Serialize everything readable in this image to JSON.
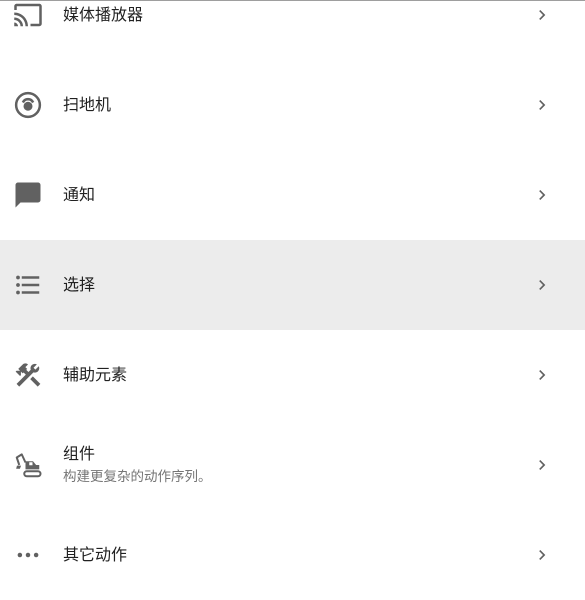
{
  "colors": {
    "icon": "#616161",
    "text": "#212121",
    "secondary_text": "#757575",
    "selected_background": "#ececec",
    "chevron": "#616161"
  },
  "menu": {
    "items": [
      {
        "label": "媒体播放器",
        "icon": "cast-icon",
        "selected": false
      },
      {
        "label": "扫地机",
        "icon": "robot-vacuum-icon",
        "selected": false
      },
      {
        "label": "通知",
        "icon": "message-icon",
        "selected": false
      },
      {
        "label": "选择",
        "icon": "format-list-bulleted-icon",
        "selected": true
      },
      {
        "label": "辅助元素",
        "icon": "tools-icon",
        "selected": false
      },
      {
        "label": "组件",
        "sublabel": "构建更复杂的动作序列。",
        "icon": "excavator-icon",
        "selected": false
      },
      {
        "label": "其它动作",
        "icon": "dots-horizontal-icon",
        "selected": false
      }
    ]
  }
}
